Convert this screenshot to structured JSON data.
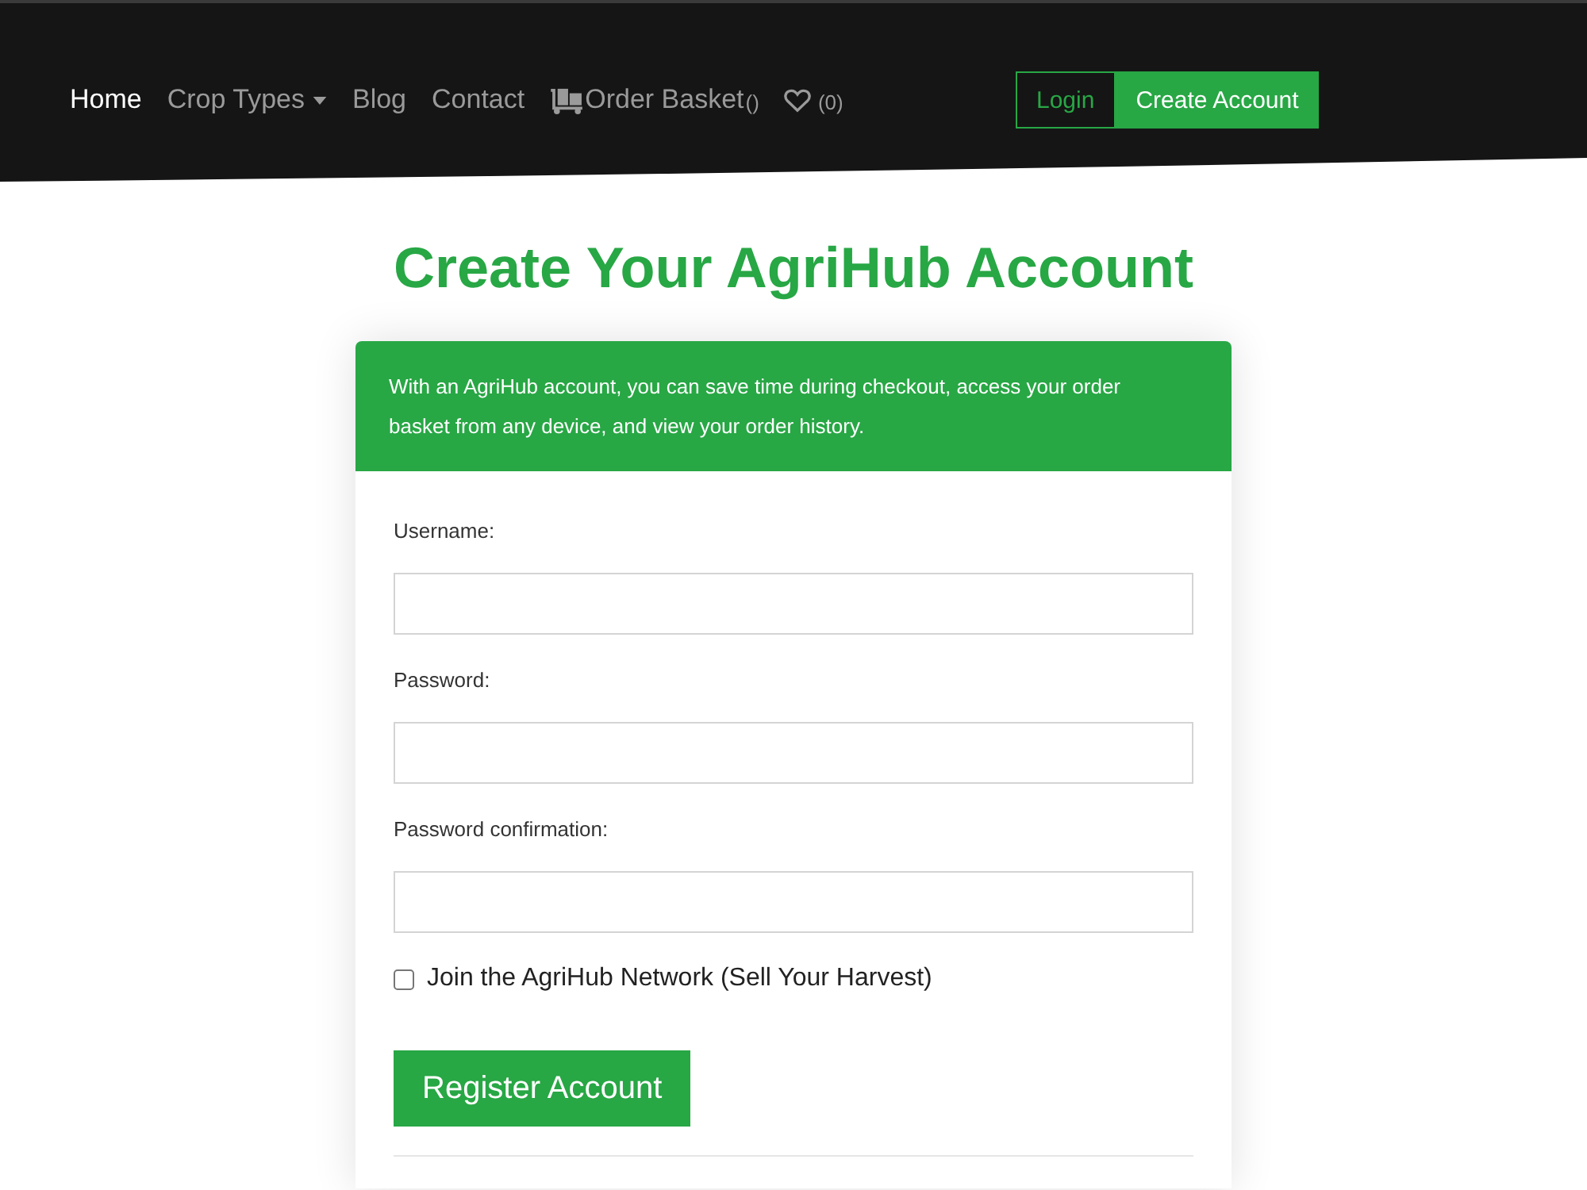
{
  "nav": {
    "items": [
      {
        "kind": "link",
        "label": "Home",
        "selected": true
      },
      {
        "kind": "dropdown",
        "label": "Crop Types",
        "selected": false
      },
      {
        "kind": "link",
        "label": "Blog",
        "selected": false
      },
      {
        "kind": "link",
        "label": "Contact",
        "selected": false
      },
      {
        "kind": "basket",
        "label": "Order Basket",
        "count": "()",
        "selected": false
      },
      {
        "kind": "wishlist",
        "count": "(0)",
        "selected": false
      }
    ],
    "auth_buttons": [
      {
        "kind": "outline",
        "label": "Login"
      },
      {
        "kind": "filled",
        "label": "Create Account"
      }
    ]
  },
  "page_title": "Create Your AgriHub Account",
  "card": {
    "intro": "With an AgriHub account, you can save time during checkout, access your order basket from any device, and view your order history.",
    "fields": [
      {
        "label": "Username:"
      },
      {
        "label": "Password:"
      },
      {
        "label": "Password confirmation:"
      }
    ],
    "checkbox": {
      "label": "Join the AgriHub Network (Sell Your Harvest)",
      "checked": false
    },
    "submit_button": "Register Account"
  }
}
